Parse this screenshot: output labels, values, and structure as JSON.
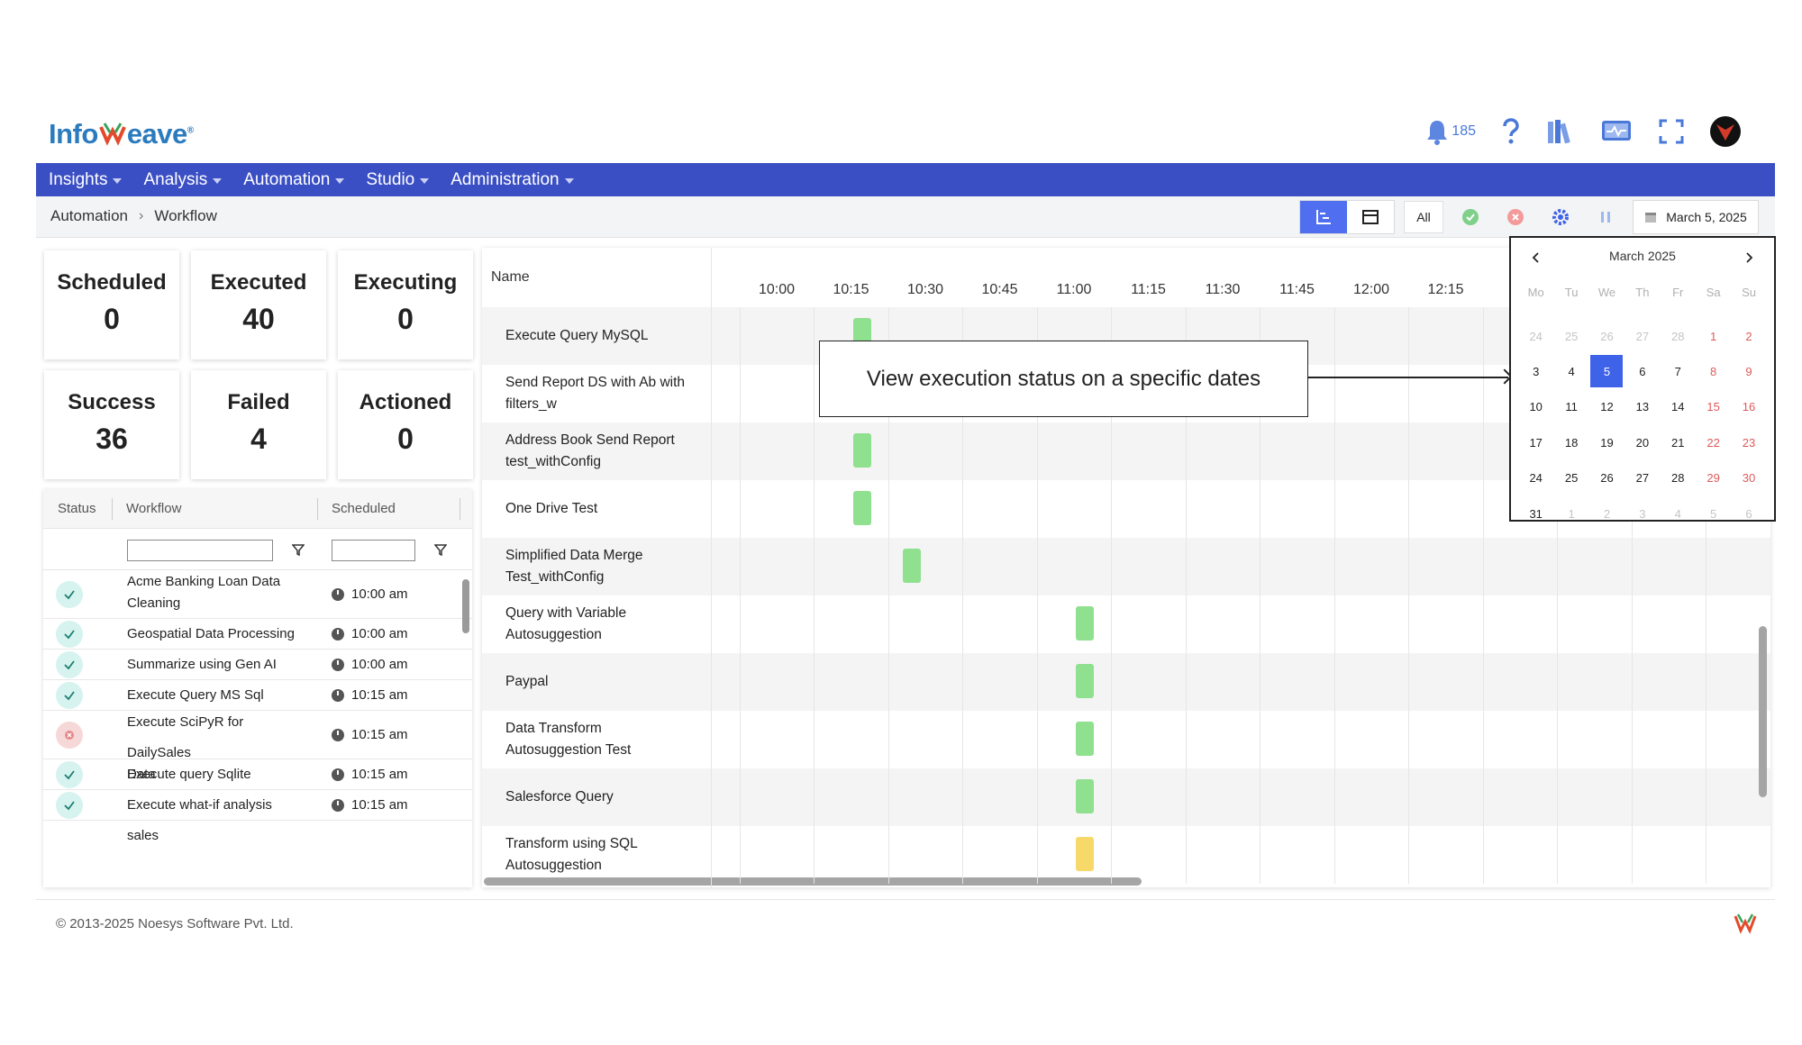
{
  "brand": {
    "name_left": "Info",
    "name_right": "eave"
  },
  "header": {
    "notifications_count": "185"
  },
  "nav": [
    {
      "label": "Insights"
    },
    {
      "label": "Analysis"
    },
    {
      "label": "Automation"
    },
    {
      "label": "Studio"
    },
    {
      "label": "Administration"
    }
  ],
  "breadcrumb": {
    "root": "Automation",
    "current": "Workflow"
  },
  "toolbar": {
    "filter_all": "All",
    "date": "March 5, 2025"
  },
  "stats": [
    {
      "label": "Scheduled",
      "value": "0"
    },
    {
      "label": "Executed",
      "value": "40"
    },
    {
      "label": "Executing",
      "value": "0"
    },
    {
      "label": "Success",
      "value": "36"
    },
    {
      "label": "Failed",
      "value": "4"
    },
    {
      "label": "Actioned",
      "value": "0"
    }
  ],
  "workflow_table": {
    "headers": {
      "status": "Status",
      "workflow": "Workflow",
      "scheduled": "Scheduled"
    },
    "rows": [
      {
        "status": "success",
        "name_line1": "Acme Banking Loan Data",
        "name_line2": "Cleaning",
        "time": "10:00 am"
      },
      {
        "status": "success",
        "name_line1": "Geospatial Data Processing",
        "name_line2": "",
        "time": "10:00 am"
      },
      {
        "status": "success",
        "name_line1": "Summarize using Gen AI",
        "name_line2": "",
        "time": "10:00 am"
      },
      {
        "status": "success",
        "name_line1": "Execute Query MS Sql",
        "name_line2": "",
        "time": "10:15 am"
      },
      {
        "status": "failed",
        "name_line1": "Execute SciPyR for DailySales",
        "name_line2": "Data",
        "time": "10:15 am"
      },
      {
        "status": "success",
        "name_line1": "Execute query Sqlite",
        "name_line2": "",
        "time": "10:15 am"
      },
      {
        "status": "success",
        "name_line1": "Execute what-if analysis sales",
        "name_line2": "",
        "time": "10:15 am"
      }
    ]
  },
  "gantt": {
    "name_header": "Name",
    "ticks": [
      "10:00",
      "10:15",
      "10:30",
      "10:45",
      "11:00",
      "11:15",
      "11:30",
      "11:45",
      "12:00",
      "12:15"
    ],
    "rows": [
      {
        "line1": "Execute Query MySQL",
        "line2": "",
        "start": "10:15",
        "status": "success"
      },
      {
        "line1": "Send Report DS with Ab with",
        "line2": "filters_w",
        "start": "",
        "status": ""
      },
      {
        "line1": "Address Book Send Report",
        "line2": "test_withConfig",
        "start": "10:15",
        "status": "success"
      },
      {
        "line1": "One Drive Test",
        "line2": "",
        "start": "10:15",
        "status": "success"
      },
      {
        "line1": "Simplified Data Merge",
        "line2": "Test_withConfig",
        "start": "10:25",
        "status": "success"
      },
      {
        "line1": "Query with Variable",
        "line2": "Autosuggestion",
        "start": "11:00",
        "status": "success"
      },
      {
        "line1": "Paypal",
        "line2": "",
        "start": "11:00",
        "status": "success"
      },
      {
        "line1": "Data Transform",
        "line2": "Autosuggestion Test",
        "start": "11:00",
        "status": "success"
      },
      {
        "line1": "Salesforce Query",
        "line2": "",
        "start": "11:00",
        "status": "success"
      },
      {
        "line1": "Transform using SQL",
        "line2": "Autosuggestion",
        "start": "11:00",
        "status": "warning"
      }
    ],
    "colors": {
      "success": "#8fe08f",
      "warning": "#f7d96a"
    }
  },
  "callout": {
    "text": "View execution status on a specific dates"
  },
  "calendar": {
    "title": "March 2025",
    "weekdays": [
      "Mo",
      "Tu",
      "We",
      "Th",
      "Fr",
      "Sa",
      "Su"
    ],
    "selected": "5",
    "weeks": [
      [
        "24",
        "25",
        "26",
        "27",
        "28",
        "1",
        "2"
      ],
      [
        "3",
        "4",
        "5",
        "6",
        "7",
        "8",
        "9"
      ],
      [
        "10",
        "11",
        "12",
        "13",
        "14",
        "15",
        "16"
      ],
      [
        "17",
        "18",
        "19",
        "20",
        "21",
        "22",
        "23"
      ],
      [
        "24",
        "25",
        "26",
        "27",
        "28",
        "29",
        "30"
      ],
      [
        "31",
        "1",
        "2",
        "3",
        "4",
        "5",
        "6"
      ]
    ]
  },
  "footer": {
    "copyright": "© 2013-2025 Noesys Software Pvt. Ltd."
  }
}
